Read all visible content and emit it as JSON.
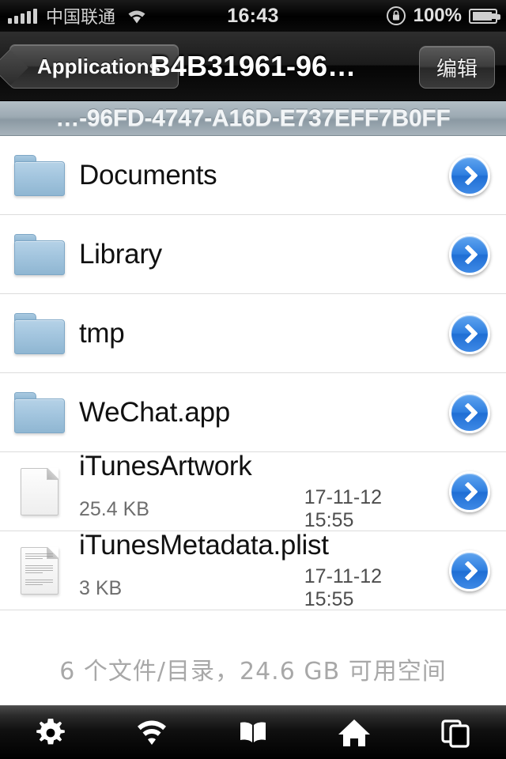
{
  "status_bar": {
    "signal_icon": "signal-bars-icon",
    "carrier": "中国联通",
    "wifi_icon": "wifi-icon",
    "time": "16:43",
    "rotation_lock_icon": "rotation-lock-icon",
    "battery_percent": "100%",
    "battery_icon": "battery-charging-icon"
  },
  "nav_bar": {
    "back_label": "Applications",
    "title": "B4B31961-96…",
    "edit_label": "编辑"
  },
  "path_bar": {
    "path": "…-96FD-4747-A16D-E737EFF7B0FF"
  },
  "list": {
    "rows": [
      {
        "name": "Documents",
        "type": "folder",
        "icon": "folder-icon",
        "size": "",
        "date": ""
      },
      {
        "name": "Library",
        "type": "folder",
        "icon": "folder-icon",
        "size": "",
        "date": ""
      },
      {
        "name": "tmp",
        "type": "folder",
        "icon": "folder-icon",
        "size": "",
        "date": ""
      },
      {
        "name": "WeChat.app",
        "type": "folder",
        "icon": "folder-icon",
        "size": "",
        "date": ""
      },
      {
        "name": "iTunesArtwork",
        "type": "file",
        "icon": "blank-document-icon",
        "size": "25.4 KB",
        "date": "17-11-12 15:55"
      },
      {
        "name": "iTunesMetadata.plist",
        "type": "file",
        "icon": "text-document-icon",
        "size": "3 KB",
        "date": "17-11-12 15:55"
      }
    ],
    "disclosure_icon": "chevron-right-circle-icon"
  },
  "footer": {
    "summary": "6 个文件/目录，24.6 GB 可用空间"
  },
  "tab_bar": {
    "tabs": [
      {
        "icon": "gear-icon"
      },
      {
        "icon": "wifi-icon"
      },
      {
        "icon": "book-icon"
      },
      {
        "icon": "home-icon"
      },
      {
        "icon": "windows-copy-icon"
      }
    ]
  },
  "colors": {
    "accent_blue": "#2f7fe0",
    "folder_blue": "#a4c6df",
    "path_bar": "#9daab3",
    "nav_bar": "#1b1b1b"
  }
}
